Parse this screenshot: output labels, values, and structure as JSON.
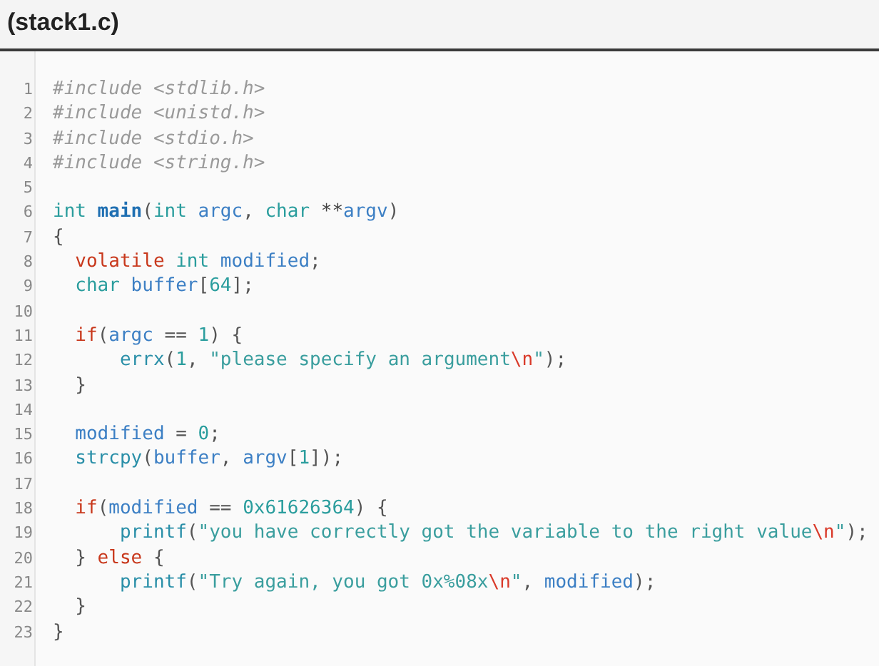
{
  "title": "(stack1.c)",
  "lines": [
    {
      "number": "1",
      "tokens": [
        {
          "kind": "pp",
          "text": "#include <stdlib.h>"
        }
      ]
    },
    {
      "number": "2",
      "tokens": [
        {
          "kind": "pp",
          "text": "#include <unistd.h>"
        }
      ]
    },
    {
      "number": "3",
      "tokens": [
        {
          "kind": "pp",
          "text": "#include <stdio.h>"
        }
      ]
    },
    {
      "number": "4",
      "tokens": [
        {
          "kind": "pp",
          "text": "#include <string.h>"
        }
      ]
    },
    {
      "number": "5"
    },
    {
      "number": "6",
      "tokens": [
        {
          "kind": "type",
          "text": "int"
        },
        {
          "kind": "fn",
          "text": " main"
        },
        {
          "kind": "p",
          "text": "("
        },
        {
          "kind": "type",
          "text": "int"
        },
        {
          "kind": "id",
          "text": " argc"
        },
        {
          "kind": "p",
          "text": ", "
        },
        {
          "kind": "type",
          "text": "char"
        },
        {
          "kind": "op",
          "text": " **"
        },
        {
          "kind": "id",
          "text": "argv"
        },
        {
          "kind": "p",
          "text": ")"
        }
      ]
    },
    {
      "number": "7",
      "tokens": [
        {
          "kind": "p",
          "text": "{"
        }
      ]
    },
    {
      "number": "8",
      "tokens": [
        {
          "kind": "kw",
          "text": "  volatile"
        },
        {
          "kind": "type",
          "text": " int"
        },
        {
          "kind": "id",
          "text": " modified"
        },
        {
          "kind": "p",
          "text": ";"
        }
      ]
    },
    {
      "number": "9",
      "tokens": [
        {
          "kind": "type",
          "text": "  char"
        },
        {
          "kind": "id",
          "text": " buffer"
        },
        {
          "kind": "p",
          "text": "["
        },
        {
          "kind": "num",
          "text": "64"
        },
        {
          "kind": "p",
          "text": "];"
        }
      ]
    },
    {
      "number": "10"
    },
    {
      "number": "11",
      "tokens": [
        {
          "kind": "kw",
          "text": "  if"
        },
        {
          "kind": "p",
          "text": "("
        },
        {
          "kind": "id",
          "text": "argc"
        },
        {
          "kind": "p",
          "text": " == "
        },
        {
          "kind": "num",
          "text": "1"
        },
        {
          "kind": "p",
          "text": ") {"
        }
      ]
    },
    {
      "number": "12",
      "tokens": [
        {
          "kind": "call",
          "text": "      errx"
        },
        {
          "kind": "p",
          "text": "("
        },
        {
          "kind": "num",
          "text": "1"
        },
        {
          "kind": "p",
          "text": ", "
        },
        {
          "kind": "str",
          "text": "\"please specify an argument"
        },
        {
          "kind": "esc",
          "text": "\\n"
        },
        {
          "kind": "str",
          "text": "\""
        },
        {
          "kind": "p",
          "text": ");"
        }
      ]
    },
    {
      "number": "13",
      "tokens": [
        {
          "kind": "p",
          "text": "  }"
        }
      ]
    },
    {
      "number": "14"
    },
    {
      "number": "15",
      "tokens": [
        {
          "kind": "id",
          "text": "  modified"
        },
        {
          "kind": "p",
          "text": " = "
        },
        {
          "kind": "num",
          "text": "0"
        },
        {
          "kind": "p",
          "text": ";"
        }
      ]
    },
    {
      "number": "16",
      "tokens": [
        {
          "kind": "call",
          "text": "  strcpy"
        },
        {
          "kind": "p",
          "text": "("
        },
        {
          "kind": "id",
          "text": "buffer"
        },
        {
          "kind": "p",
          "text": ", "
        },
        {
          "kind": "id",
          "text": "argv"
        },
        {
          "kind": "p",
          "text": "["
        },
        {
          "kind": "num",
          "text": "1"
        },
        {
          "kind": "p",
          "text": "]);"
        }
      ]
    },
    {
      "number": "17"
    },
    {
      "number": "18",
      "tokens": [
        {
          "kind": "kw",
          "text": "  if"
        },
        {
          "kind": "p",
          "text": "("
        },
        {
          "kind": "id",
          "text": "modified"
        },
        {
          "kind": "p",
          "text": " == "
        },
        {
          "kind": "num",
          "text": "0x61626364"
        },
        {
          "kind": "p",
          "text": ") {"
        }
      ]
    },
    {
      "number": "19",
      "tokens": [
        {
          "kind": "call",
          "text": "      printf"
        },
        {
          "kind": "p",
          "text": "("
        },
        {
          "kind": "str",
          "text": "\"you have correctly got the variable to the right value"
        },
        {
          "kind": "esc",
          "text": "\\n"
        },
        {
          "kind": "str",
          "text": "\""
        },
        {
          "kind": "p",
          "text": ");"
        }
      ]
    },
    {
      "number": "20",
      "tokens": [
        {
          "kind": "p",
          "text": "  }"
        },
        {
          "kind": "kw",
          "text": " else"
        },
        {
          "kind": "p",
          "text": " {"
        }
      ]
    },
    {
      "number": "21",
      "tokens": [
        {
          "kind": "call",
          "text": "      printf"
        },
        {
          "kind": "p",
          "text": "("
        },
        {
          "kind": "str",
          "text": "\"Try again, you got 0x%08x"
        },
        {
          "kind": "esc",
          "text": "\\n"
        },
        {
          "kind": "str",
          "text": "\""
        },
        {
          "kind": "p",
          "text": ", "
        },
        {
          "kind": "id",
          "text": "modified"
        },
        {
          "kind": "p",
          "text": ");"
        }
      ]
    },
    {
      "number": "22",
      "tokens": [
        {
          "kind": "p",
          "text": "  }"
        }
      ]
    },
    {
      "number": "23",
      "tokens": [
        {
          "kind": "p",
          "text": "}"
        }
      ]
    }
  ]
}
